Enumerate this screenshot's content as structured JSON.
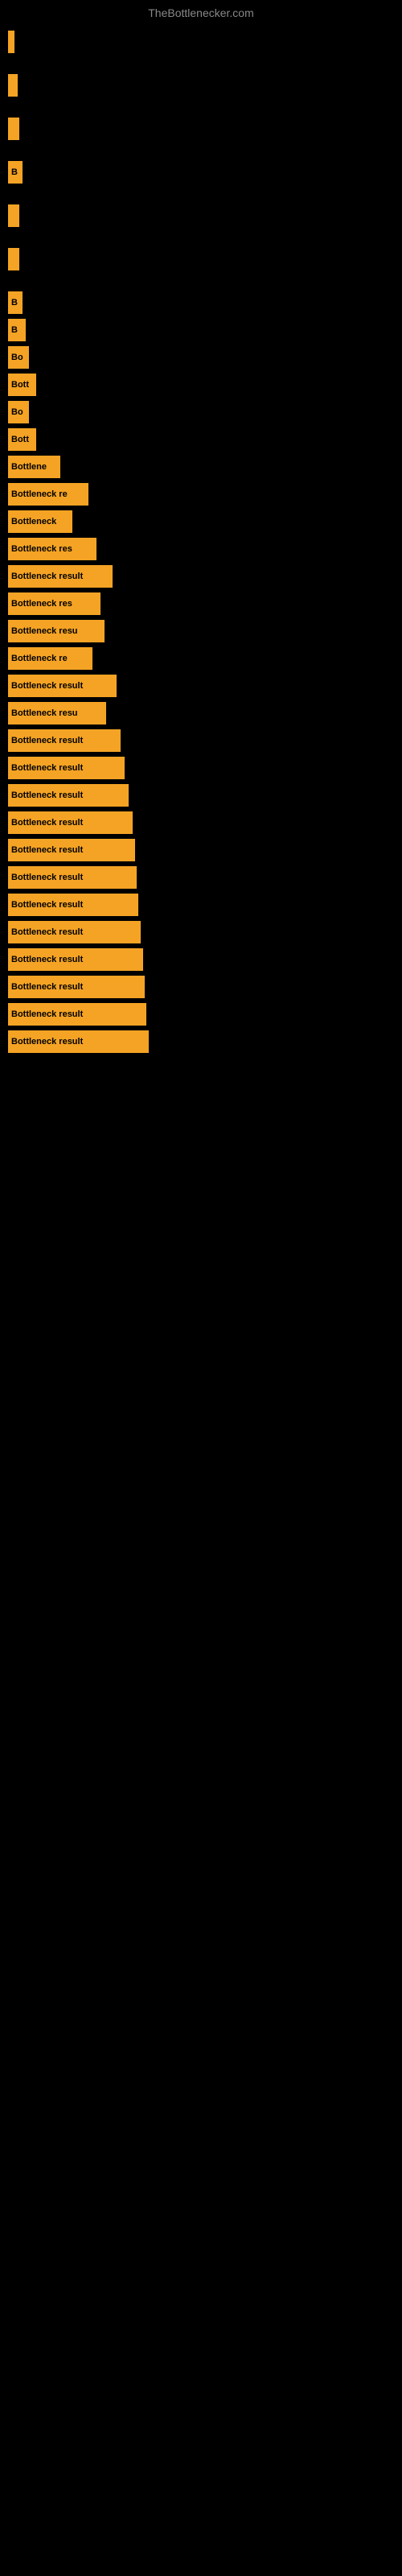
{
  "site": {
    "title": "TheBottlenecker.com"
  },
  "bars": [
    {
      "id": 1,
      "label": "",
      "width": 8,
      "visible_text": ""
    },
    {
      "id": 2,
      "label": "",
      "width": 12,
      "visible_text": ""
    },
    {
      "id": 3,
      "label": "",
      "width": 14,
      "visible_text": ""
    },
    {
      "id": 4,
      "label": "B",
      "width": 18,
      "visible_text": "B"
    },
    {
      "id": 5,
      "label": "",
      "width": 14,
      "visible_text": ""
    },
    {
      "id": 6,
      "label": "",
      "width": 14,
      "visible_text": ""
    },
    {
      "id": 7,
      "label": "B",
      "width": 18,
      "visible_text": "B"
    },
    {
      "id": 8,
      "label": "B",
      "width": 22,
      "visible_text": "B"
    },
    {
      "id": 9,
      "label": "Bo",
      "width": 26,
      "visible_text": "Bo"
    },
    {
      "id": 10,
      "label": "Bott",
      "width": 35,
      "visible_text": "Bott"
    },
    {
      "id": 11,
      "label": "Bo",
      "width": 26,
      "visible_text": "Bo"
    },
    {
      "id": 12,
      "label": "Bott",
      "width": 35,
      "visible_text": "Bott"
    },
    {
      "id": 13,
      "label": "Bottlene",
      "width": 65,
      "visible_text": "Bottlene"
    },
    {
      "id": 14,
      "label": "Bottleneck re",
      "width": 100,
      "visible_text": "Bottleneck re"
    },
    {
      "id": 15,
      "label": "Bottleneck",
      "width": 80,
      "visible_text": "Bottleneck"
    },
    {
      "id": 16,
      "label": "Bottleneck res",
      "width": 110,
      "visible_text": "Bottleneck res"
    },
    {
      "id": 17,
      "label": "Bottleneck result",
      "width": 130,
      "visible_text": "Bottleneck result"
    },
    {
      "id": 18,
      "label": "Bottleneck res",
      "width": 115,
      "visible_text": "Bottleneck res"
    },
    {
      "id": 19,
      "label": "Bottleneck resu",
      "width": 120,
      "visible_text": "Bottleneck resu"
    },
    {
      "id": 20,
      "label": "Bottleneck re",
      "width": 105,
      "visible_text": "Bottleneck re"
    },
    {
      "id": 21,
      "label": "Bottleneck result",
      "width": 135,
      "visible_text": "Bottleneck result"
    },
    {
      "id": 22,
      "label": "Bottleneck resu",
      "width": 122,
      "visible_text": "Bottleneck resu"
    },
    {
      "id": 23,
      "label": "Bottleneck result",
      "width": 140,
      "visible_text": "Bottleneck result"
    },
    {
      "id": 24,
      "label": "Bottleneck result",
      "width": 145,
      "visible_text": "Bottleneck result"
    },
    {
      "id": 25,
      "label": "Bottleneck result",
      "width": 150,
      "visible_text": "Bottleneck result"
    },
    {
      "id": 26,
      "label": "Bottleneck result",
      "width": 155,
      "visible_text": "Bottleneck result"
    },
    {
      "id": 27,
      "label": "Bottleneck result",
      "width": 158,
      "visible_text": "Bottleneck result"
    },
    {
      "id": 28,
      "label": "Bottleneck result",
      "width": 160,
      "visible_text": "Bottleneck result"
    },
    {
      "id": 29,
      "label": "Bottleneck result",
      "width": 162,
      "visible_text": "Bottleneck result"
    },
    {
      "id": 30,
      "label": "Bottleneck result",
      "width": 165,
      "visible_text": "Bottleneck result"
    },
    {
      "id": 31,
      "label": "Bottleneck result",
      "width": 168,
      "visible_text": "Bottleneck result"
    },
    {
      "id": 32,
      "label": "Bottleneck result",
      "width": 170,
      "visible_text": "Bottleneck result"
    },
    {
      "id": 33,
      "label": "Bottleneck result",
      "width": 172,
      "visible_text": "Bottleneck result"
    },
    {
      "id": 34,
      "label": "Bottleneck result",
      "width": 175,
      "visible_text": "Bottleneck result"
    }
  ]
}
